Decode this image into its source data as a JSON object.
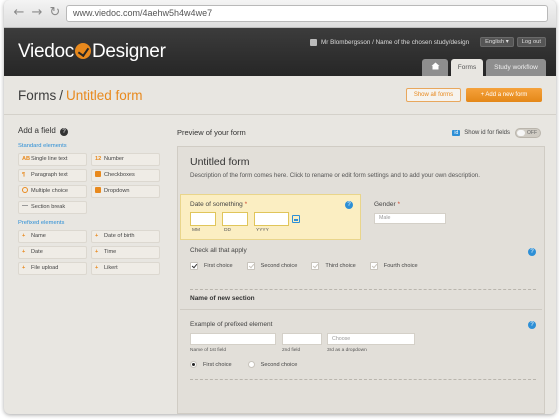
{
  "browser": {
    "url": "www.viedoc.com/4aehw5h4w4we7"
  },
  "header": {
    "logo_left": "Viedoc",
    "logo_right": "Designer",
    "user_text": "Mr Blombergsson / Name of the chosen study/design",
    "language": "English",
    "logout": "Log out",
    "tabs": {
      "forms": "Forms",
      "workflow": "Study workflow"
    }
  },
  "page": {
    "title": "Forms",
    "separator": "/",
    "form_name": "Untitled form",
    "show_all_label": "Show all forms",
    "add_form_label": "+ Add a new form"
  },
  "left": {
    "heading": "Add a field",
    "standard_label": "Standard elements",
    "standard": [
      {
        "icon": "AB",
        "label": "Single line text"
      },
      {
        "icon": "12",
        "label": "Number"
      },
      {
        "icon": "¶",
        "label": "Paragraph text"
      },
      {
        "icon": "box",
        "label": "Checkboxes"
      },
      {
        "icon": "radio",
        "label": "Multiple choice"
      },
      {
        "icon": "box",
        "label": "Dropdown"
      },
      {
        "icon": "dash",
        "label": "Section break"
      }
    ],
    "prefixed_label": "Prefixed elements",
    "prefixed": [
      {
        "label": "Name"
      },
      {
        "label": "Date of birth"
      },
      {
        "label": "Date"
      },
      {
        "label": "Time"
      },
      {
        "label": "File upload"
      },
      {
        "label": "Likert"
      }
    ]
  },
  "preview": {
    "heading": "Preview of your form",
    "id_badge": "id",
    "show_id_label": "Show id for fields",
    "toggle_state": "OFF",
    "form_title": "Untitled form",
    "form_desc": "Description of the form comes here. Click to rename or edit form settings and to add your own description.",
    "date_field": {
      "label": "Date of something",
      "required": "*",
      "captions": [
        "MM",
        "DD",
        "YYYY"
      ]
    },
    "gender": {
      "label": "Gender",
      "required": "*",
      "value": "Male"
    },
    "checkboxes": {
      "label": "Check all that apply",
      "options": [
        {
          "label": "First choice",
          "checked": true
        },
        {
          "label": "Second choice",
          "checked": false
        },
        {
          "label": "Third choice",
          "checked": false
        },
        {
          "label": "Fourth choice",
          "checked": false
        }
      ]
    },
    "section": {
      "title": "Name of new section"
    },
    "prefixed": {
      "label": "Example of prefixed element",
      "captions": [
        "Name of 1st field",
        "2nd field",
        "3rd as a dropdown"
      ],
      "dropdown_placeholder": "Choose"
    },
    "radios": [
      {
        "label": "First choice",
        "selected": true
      },
      {
        "label": "Second choice",
        "selected": false
      }
    ]
  },
  "colors": {
    "accent": "#e8891d",
    "info": "#2d8fd6",
    "header": "#2b2b2b"
  }
}
